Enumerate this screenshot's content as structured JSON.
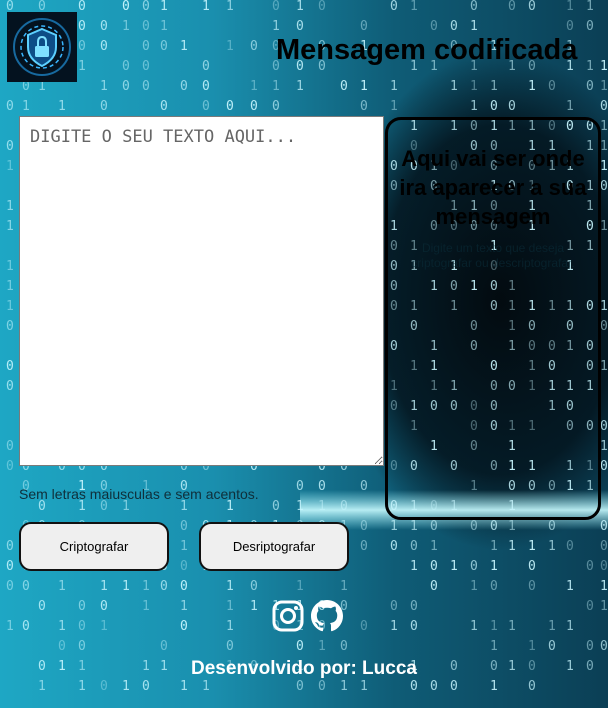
{
  "header": {
    "title": "Mensagem codificada",
    "logo_icon": "shield-lock-icon"
  },
  "input": {
    "placeholder": "DIGITE O SEU TEXTO AQUI...",
    "value": ""
  },
  "hint": "Sem letras maiusculas e sem acentos.",
  "buttons": {
    "encrypt_label": "Criptografar",
    "decrypt_label": "Desriptografar"
  },
  "output": {
    "heading": "Aqui vai ser onde ira aparecer a sua mensagem",
    "subtext": "Digite um texto que deseja criptografar ou descriptografar."
  },
  "footer": {
    "instagram_icon": "instagram-icon",
    "github_icon": "github-icon",
    "credit": "Desenvolvido por: Lucca"
  },
  "colors": {
    "accent": "#2fd3e6",
    "background_dark": "#06202c",
    "button_bg": "#efefef",
    "footer_text": "#ffffff"
  }
}
